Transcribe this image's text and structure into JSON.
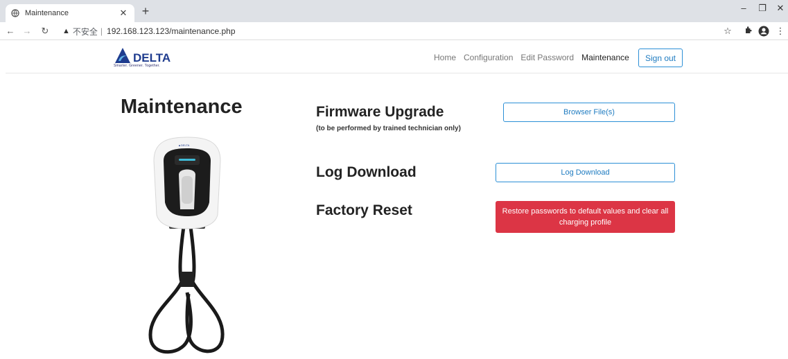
{
  "browser": {
    "tab_title": "Maintenance",
    "insecure_label": "不安全",
    "separator": "|",
    "url": "192.168.123.123/maintenance.php"
  },
  "header": {
    "logo_text": "DELTA",
    "logo_tagline": "Smarter. Greener. Together.",
    "nav": [
      "Home",
      "Configuration",
      "Edit Password",
      "Maintenance"
    ],
    "active_nav": "Maintenance",
    "signout_label": "Sign out"
  },
  "main": {
    "page_title": "Maintenance",
    "firmware": {
      "title": "Firmware Upgrade",
      "note": "(to be performed by trained technician only)",
      "button_label": "Browser File(s)"
    },
    "log": {
      "title": "Log Download",
      "button_label": "Log Download"
    },
    "reset": {
      "title": "Factory Reset",
      "button_label": "Restore passwords to default values and clear all charging profile"
    }
  },
  "colors": {
    "primary": "#1e7bc0",
    "danger": "#dc3545",
    "brand": "#1f3c8f"
  }
}
